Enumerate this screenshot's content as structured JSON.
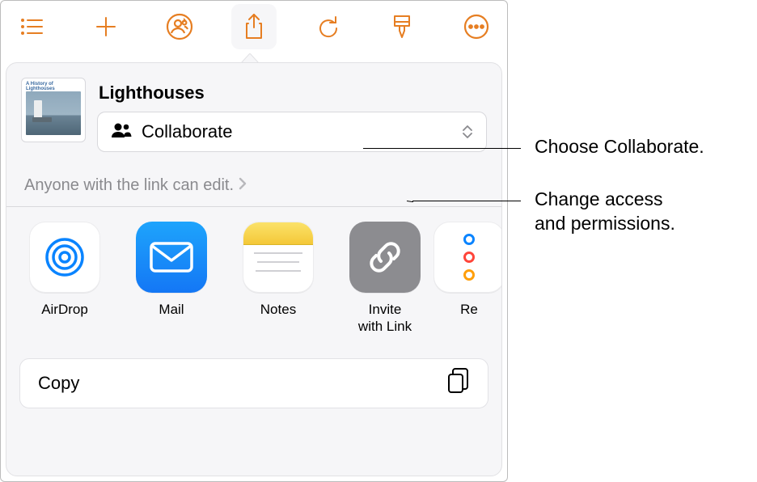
{
  "toolbar": {
    "icons": [
      "list-icon",
      "add-icon",
      "people-icon",
      "share-icon",
      "undo-icon",
      "brush-icon",
      "more-icon"
    ]
  },
  "document": {
    "title": "Lighthouses",
    "thumb_caption": "A History of Lighthouses",
    "dropdown_label": "Collaborate",
    "permission_text": "Anyone with the link can edit."
  },
  "apps": [
    {
      "name": "airdrop",
      "label": "AirDrop"
    },
    {
      "name": "mail",
      "label": "Mail"
    },
    {
      "name": "notes",
      "label": "Notes"
    },
    {
      "name": "invite",
      "label": "Invite\nwith Link"
    },
    {
      "name": "reminders",
      "label": "Re"
    }
  ],
  "actions": {
    "copy": "Copy"
  },
  "callouts": {
    "choose": "Choose Collaborate.",
    "permissions_l1": "Change access",
    "permissions_l2": "and permissions."
  }
}
